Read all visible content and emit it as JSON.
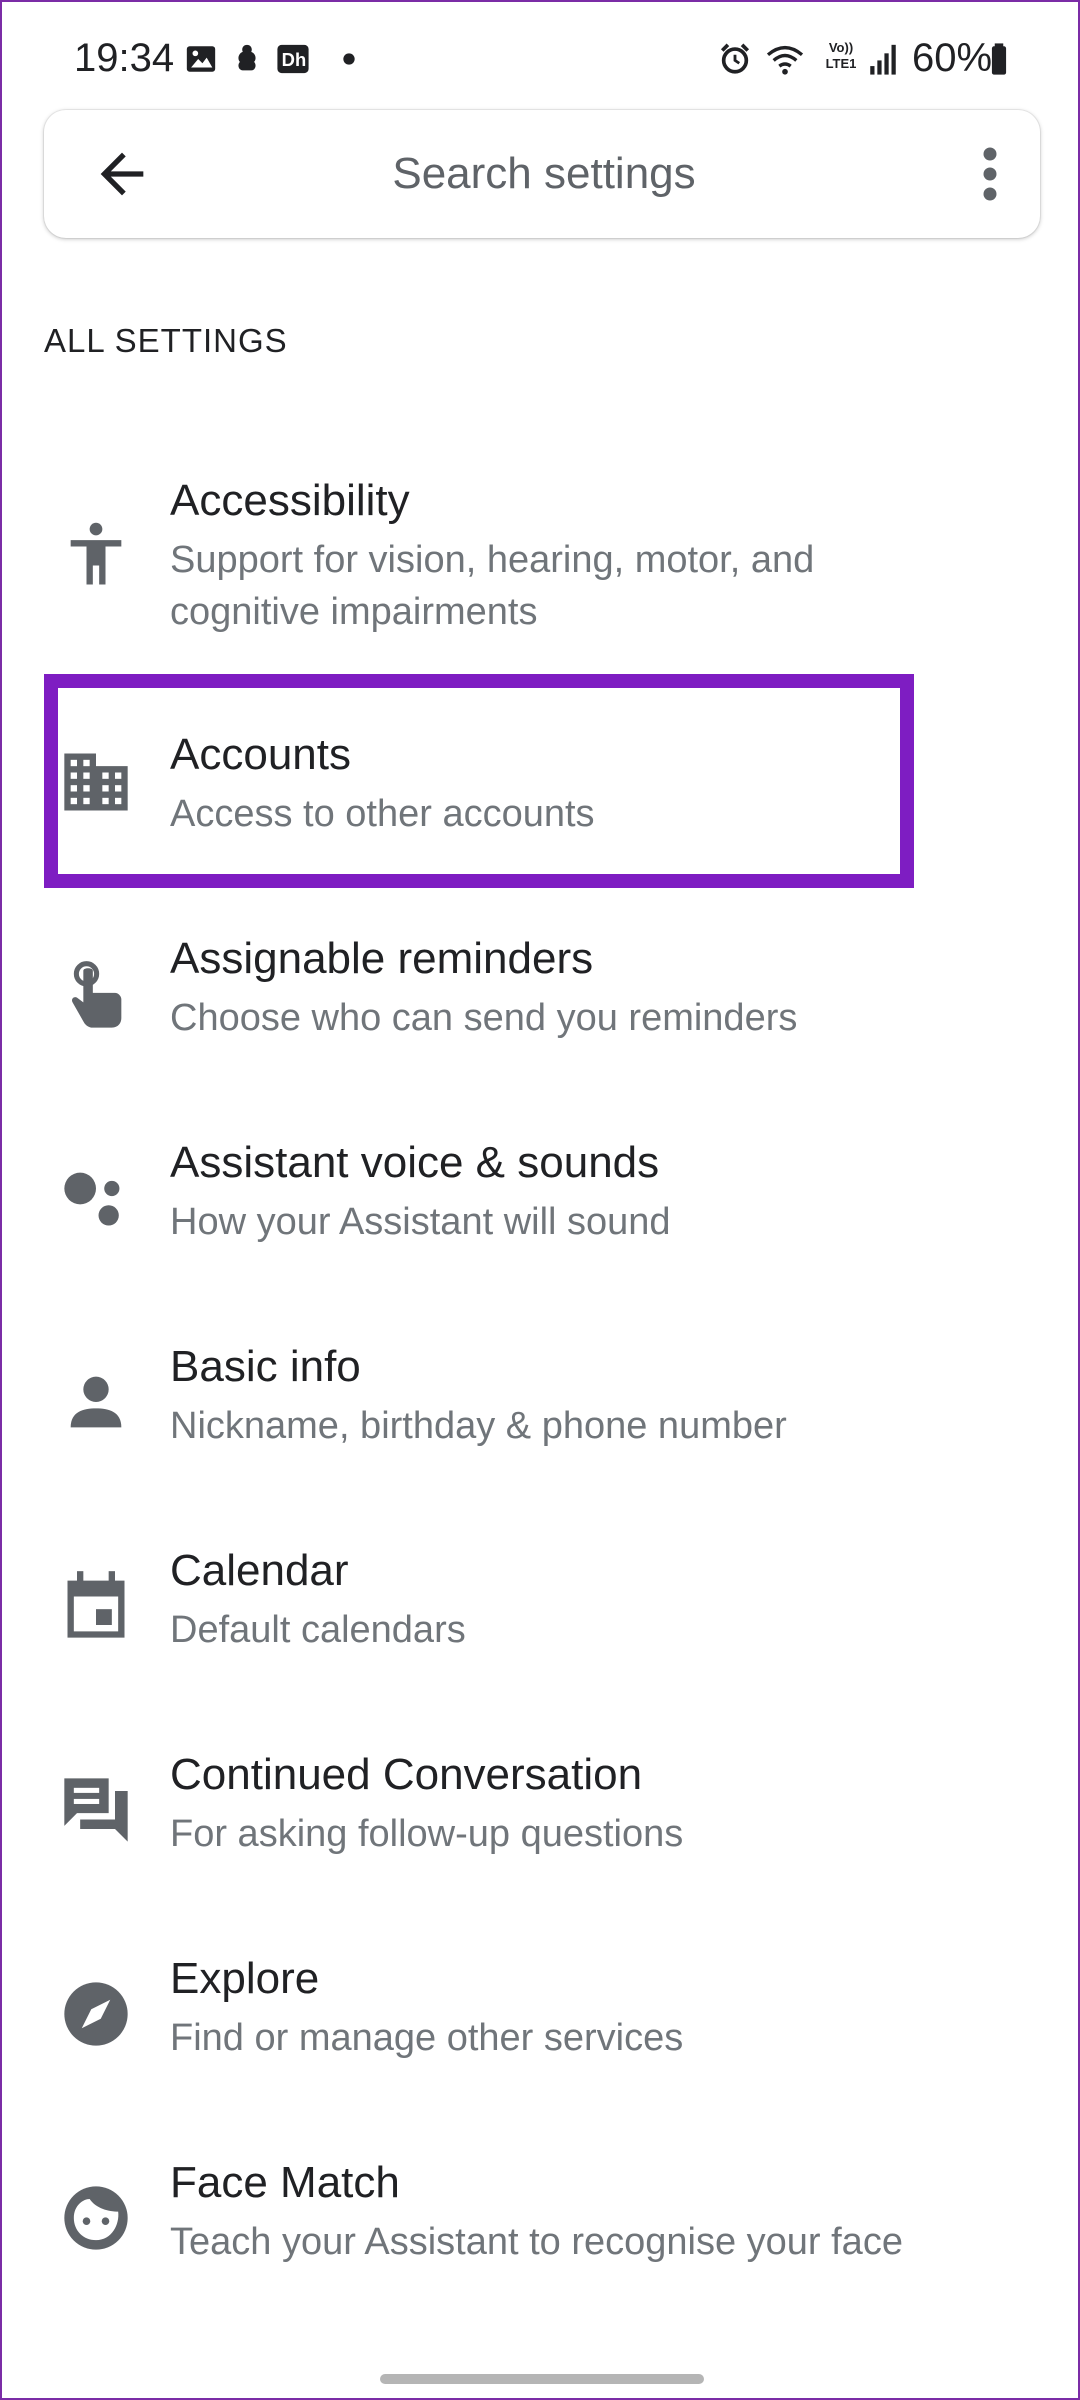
{
  "status": {
    "time": "19:34",
    "battery": "60%",
    "icons": [
      "image-icon",
      "game-icon",
      "app-icon",
      "dot-icon",
      "alarm-icon",
      "wifi-icon",
      "volte-icon",
      "signal-icon",
      "battery-icon"
    ],
    "volte_text": "Vo)) LTE1"
  },
  "search": {
    "placeholder": "Search settings"
  },
  "section_header": "ALL SETTINGS",
  "settings": [
    {
      "title": "Accessibility",
      "subtitle": "Support for vision, hearing, motor, and cognitive impairments",
      "icon": "accessibility-icon"
    },
    {
      "title": "Accounts",
      "subtitle": "Access to other accounts",
      "icon": "building-icon",
      "highlighted": true
    },
    {
      "title": "Assignable reminders",
      "subtitle": "Choose who can send you reminders",
      "icon": "touch-icon"
    },
    {
      "title": "Assistant voice & sounds",
      "subtitle": "How your Assistant will sound",
      "icon": "assistant-icon"
    },
    {
      "title": "Basic info",
      "subtitle": "Nickname, birthday & phone number",
      "icon": "person-icon"
    },
    {
      "title": "Calendar",
      "subtitle": "Default calendars",
      "icon": "calendar-icon"
    },
    {
      "title": "Continued Conversation",
      "subtitle": "For asking follow-up questions",
      "icon": "chat-icon"
    },
    {
      "title": "Explore",
      "subtitle": "Find or manage other services",
      "icon": "compass-icon"
    },
    {
      "title": "Face Match",
      "subtitle": "Teach your Assistant to recognise your face",
      "icon": "face-icon"
    }
  ],
  "colors": {
    "highlight": "#7e1dc2",
    "icon": "#5f6368",
    "subtitle": "#70757a"
  }
}
